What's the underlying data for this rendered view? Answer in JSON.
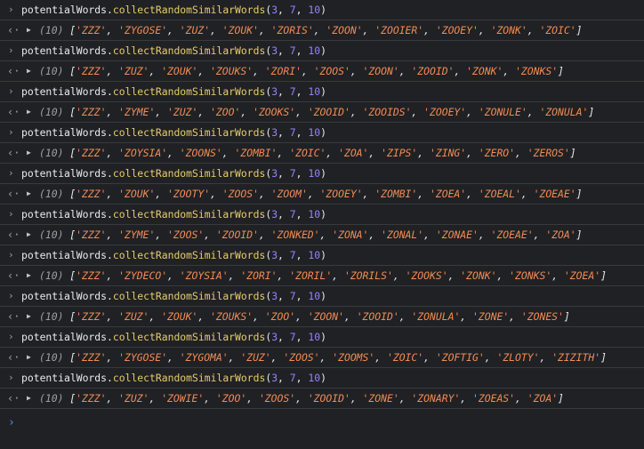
{
  "console": {
    "prompt_glyph": "›",
    "result_glyph": "‹·",
    "expand_glyph": "▶",
    "entries": [
      {
        "command": {
          "object": "potentialWords",
          "dot": ".",
          "method": "collectRandomSimilarWords",
          "open": "(",
          "a1": "3",
          "sep1": ", ",
          "a2": "7",
          "sep2": ", ",
          "a3": "10",
          "close": ")"
        },
        "result": {
          "count": "(10)",
          "words": [
            "ZZZ",
            "ZYGOSE",
            "ZUZ",
            "ZOUK",
            "ZORIS",
            "ZOON",
            "ZOOIER",
            "ZOOEY",
            "ZONK",
            "ZOIC"
          ]
        }
      },
      {
        "command": {
          "object": "potentialWords",
          "dot": ".",
          "method": "collectRandomSimilarWords",
          "open": "(",
          "a1": "3",
          "sep1": ", ",
          "a2": "7",
          "sep2": ", ",
          "a3": "10",
          "close": ")"
        },
        "result": {
          "count": "(10)",
          "words": [
            "ZZZ",
            "ZUZ",
            "ZOUK",
            "ZOUKS",
            "ZORI",
            "ZOOS",
            "ZOON",
            "ZOOID",
            "ZONK",
            "ZONKS"
          ]
        }
      },
      {
        "command": {
          "object": "potentialWords",
          "dot": ".",
          "method": "collectRandomSimilarWords",
          "open": "(",
          "a1": "3",
          "sep1": ", ",
          "a2": "7",
          "sep2": ", ",
          "a3": "10",
          "close": ")"
        },
        "result": {
          "count": "(10)",
          "words": [
            "ZZZ",
            "ZYME",
            "ZUZ",
            "ZOO",
            "ZOOKS",
            "ZOOID",
            "ZOOIDS",
            "ZOOEY",
            "ZONULE",
            "ZONULA"
          ]
        }
      },
      {
        "command": {
          "object": "potentialWords",
          "dot": ".",
          "method": "collectRandomSimilarWords",
          "open": "(",
          "a1": "3",
          "sep1": ", ",
          "a2": "7",
          "sep2": ", ",
          "a3": "10",
          "close": ")"
        },
        "result": {
          "count": "(10)",
          "words": [
            "ZZZ",
            "ZOYSIA",
            "ZOONS",
            "ZOMBI",
            "ZOIC",
            "ZOA",
            "ZIPS",
            "ZING",
            "ZERO",
            "ZEROS"
          ]
        }
      },
      {
        "command": {
          "object": "potentialWords",
          "dot": ".",
          "method": "collectRandomSimilarWords",
          "open": "(",
          "a1": "3",
          "sep1": ", ",
          "a2": "7",
          "sep2": ", ",
          "a3": "10",
          "close": ")"
        },
        "result": {
          "count": "(10)",
          "words": [
            "ZZZ",
            "ZOUK",
            "ZOOTY",
            "ZOOS",
            "ZOOM",
            "ZOOEY",
            "ZOMBI",
            "ZOEA",
            "ZOEAL",
            "ZOEAE"
          ]
        }
      },
      {
        "command": {
          "object": "potentialWords",
          "dot": ".",
          "method": "collectRandomSimilarWords",
          "open": "(",
          "a1": "3",
          "sep1": ", ",
          "a2": "7",
          "sep2": ", ",
          "a3": "10",
          "close": ")"
        },
        "result": {
          "count": "(10)",
          "words": [
            "ZZZ",
            "ZYME",
            "ZOOS",
            "ZOOID",
            "ZONKED",
            "ZONA",
            "ZONAL",
            "ZONAE",
            "ZOEAE",
            "ZOA"
          ]
        }
      },
      {
        "command": {
          "object": "potentialWords",
          "dot": ".",
          "method": "collectRandomSimilarWords",
          "open": "(",
          "a1": "3",
          "sep1": ", ",
          "a2": "7",
          "sep2": ", ",
          "a3": "10",
          "close": ")"
        },
        "result": {
          "count": "(10)",
          "words": [
            "ZZZ",
            "ZYDECO",
            "ZOYSIA",
            "ZORI",
            "ZORIL",
            "ZORILS",
            "ZOOKS",
            "ZONK",
            "ZONKS",
            "ZOEA"
          ]
        }
      },
      {
        "command": {
          "object": "potentialWords",
          "dot": ".",
          "method": "collectRandomSimilarWords",
          "open": "(",
          "a1": "3",
          "sep1": ", ",
          "a2": "7",
          "sep2": ", ",
          "a3": "10",
          "close": ")"
        },
        "result": {
          "count": "(10)",
          "words": [
            "ZZZ",
            "ZUZ",
            "ZOUK",
            "ZOUKS",
            "ZOO",
            "ZOON",
            "ZOOID",
            "ZONULA",
            "ZONE",
            "ZONES"
          ]
        }
      },
      {
        "command": {
          "object": "potentialWords",
          "dot": ".",
          "method": "collectRandomSimilarWords",
          "open": "(",
          "a1": "3",
          "sep1": ", ",
          "a2": "7",
          "sep2": ", ",
          "a3": "10",
          "close": ")"
        },
        "result": {
          "count": "(10)",
          "words": [
            "ZZZ",
            "ZYGOSE",
            "ZYGOMA",
            "ZUZ",
            "ZOOS",
            "ZOOMS",
            "ZOIC",
            "ZOFTIG",
            "ZLOTY",
            "ZIZITH"
          ]
        }
      },
      {
        "command": {
          "object": "potentialWords",
          "dot": ".",
          "method": "collectRandomSimilarWords",
          "open": "(",
          "a1": "3",
          "sep1": ", ",
          "a2": "7",
          "sep2": ", ",
          "a3": "10",
          "close": ")"
        },
        "result": {
          "count": "(10)",
          "words": [
            "ZZZ",
            "ZUZ",
            "ZOWIE",
            "ZOO",
            "ZOOS",
            "ZOOID",
            "ZONE",
            "ZONARY",
            "ZOEAS",
            "ZOA"
          ]
        }
      }
    ]
  },
  "colors": {
    "background": "#202124",
    "method": "#e6cd69",
    "number": "#9980ff",
    "string": "#f28b54",
    "prompt": "#4e8ff7"
  }
}
